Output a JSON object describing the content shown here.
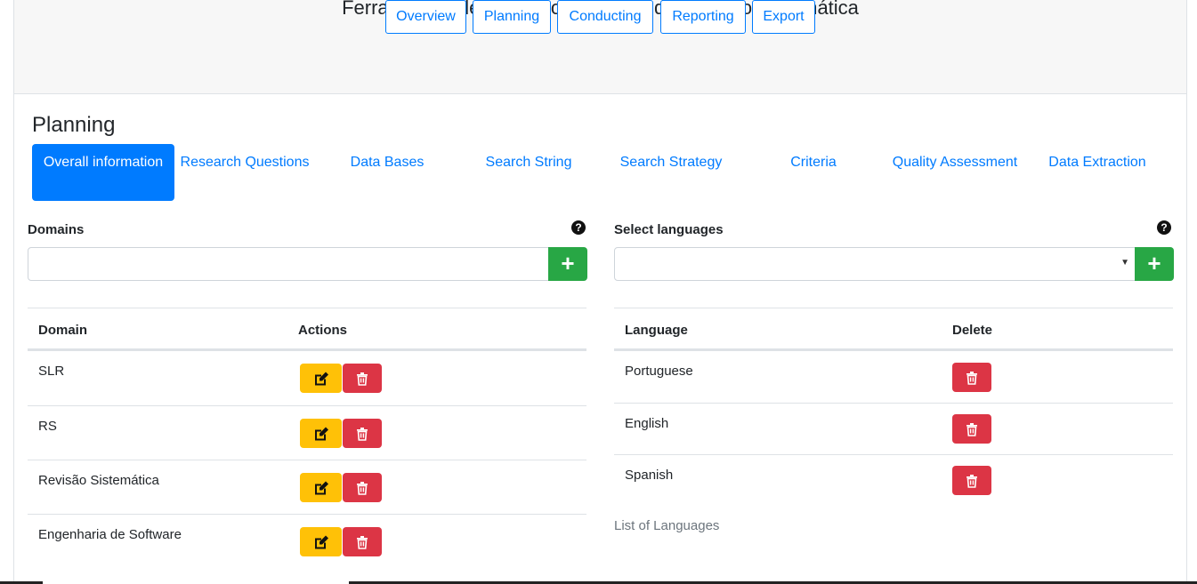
{
  "app": {
    "title": "Ferramentas de Apoio ao Processo de Revisão Sistemática"
  },
  "top_nav": [
    {
      "label": "Overview"
    },
    {
      "label": "Planning"
    },
    {
      "label": "Conducting"
    },
    {
      "label": "Reporting"
    },
    {
      "label": "Export"
    }
  ],
  "section": {
    "title": "Planning"
  },
  "tabs": [
    {
      "label": "Overall information",
      "active": true
    },
    {
      "label": "Research Questions"
    },
    {
      "label": "Data Bases"
    },
    {
      "label": "Search String"
    },
    {
      "label": "Search Strategy"
    },
    {
      "label": "Criteria"
    },
    {
      "label": "Quality Assessment"
    },
    {
      "label": "Data Extraction"
    }
  ],
  "domains": {
    "label": "Domains",
    "input_value": "",
    "table": {
      "headers": [
        "Domain",
        "Actions"
      ],
      "rows": [
        {
          "domain": "SLR"
        },
        {
          "domain": "RS"
        },
        {
          "domain": "Revisão Sistemática"
        },
        {
          "domain": "Engenharia de Software"
        }
      ]
    }
  },
  "languages": {
    "label": "Select languages",
    "selected": "",
    "table": {
      "headers": [
        "Language",
        "Delete"
      ],
      "rows": [
        {
          "language": "Portuguese"
        },
        {
          "language": "English"
        },
        {
          "language": "Spanish"
        }
      ]
    },
    "caption": "List of Languages"
  },
  "icons": {
    "help": "question-circle-icon",
    "add": "plus-icon",
    "edit": "edit-icon",
    "delete": "trash-icon",
    "caret": "caret-down-icon"
  },
  "colors": {
    "primary": "#007bff",
    "success": "#28a745",
    "warning": "#ffc107",
    "danger": "#dc3545"
  }
}
